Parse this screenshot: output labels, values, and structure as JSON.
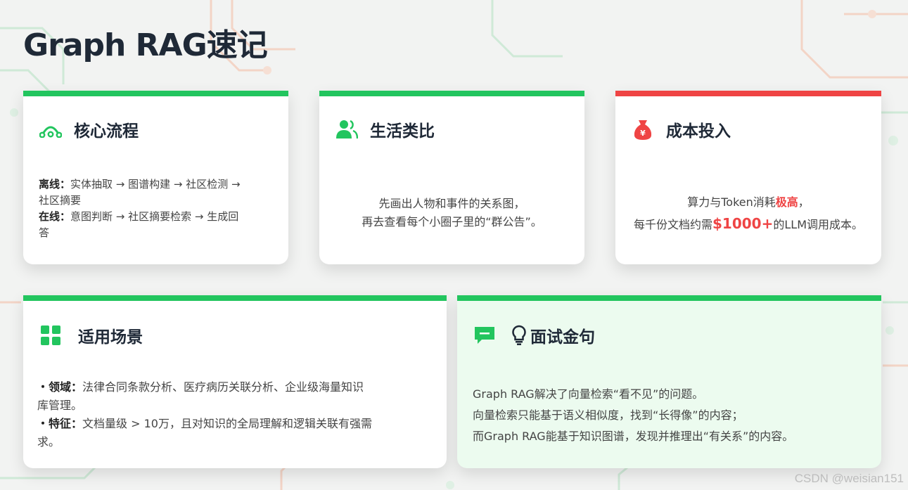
{
  "title": "Graph RAG速记",
  "colors": {
    "accent": "#22c55e",
    "alert": "#ef4444",
    "text": "#1f2937"
  },
  "cards": {
    "process": {
      "icon": "network-icon",
      "title": "核心流程",
      "line1_label": "离线：",
      "line1_text": "实体抽取 → 图谱构建 → 社区检测 →",
      "line1b_text": "社区摘要",
      "line2_label": "在线：",
      "line2_text": "意图判断 → 社区摘要检索 → 生成回",
      "line2b_text": "答"
    },
    "analogy": {
      "icon": "users-icon",
      "title": "生活类比",
      "line1": "先画出人物和事件的关系图，",
      "line2": "再去查看每个小圈子里的“群公告”。"
    },
    "cost": {
      "icon": "money-bag-icon",
      "title": "成本投入",
      "line1_prefix": "算力与Token消耗",
      "line1_highlight": "极高",
      "line1_suffix": "，",
      "line2_prefix": "每千份文档约需",
      "line2_highlight": "$1000+",
      "line2_suffix": "的LLM调用成本。"
    },
    "scenarios": {
      "icon": "grid-icon",
      "title": "适用场景",
      "item1_label": "・领域：",
      "item1_text": "法律合同条款分析、医疗病历关联分析、企业级海量知识",
      "item1b_text": "库管理。",
      "item2_label": "・特征：",
      "item2_text": "文档量级 > 10万，且对知识的全局理解和逻辑关联有强需",
      "item2b_text": "求。"
    },
    "interview": {
      "icon": "chat-icon",
      "icon2": "lightbulb-icon",
      "title": "面试金句",
      "line1": "Graph RAG解决了向量检索“看不见”的问题。",
      "line2": "向量检索只能基于语义相似度，找到“长得像”的内容；",
      "line3": "而Graph RAG能基于知识图谱，发现并推理出“有关系”的内容。"
    }
  },
  "watermark": "CSDN @weisian151"
}
